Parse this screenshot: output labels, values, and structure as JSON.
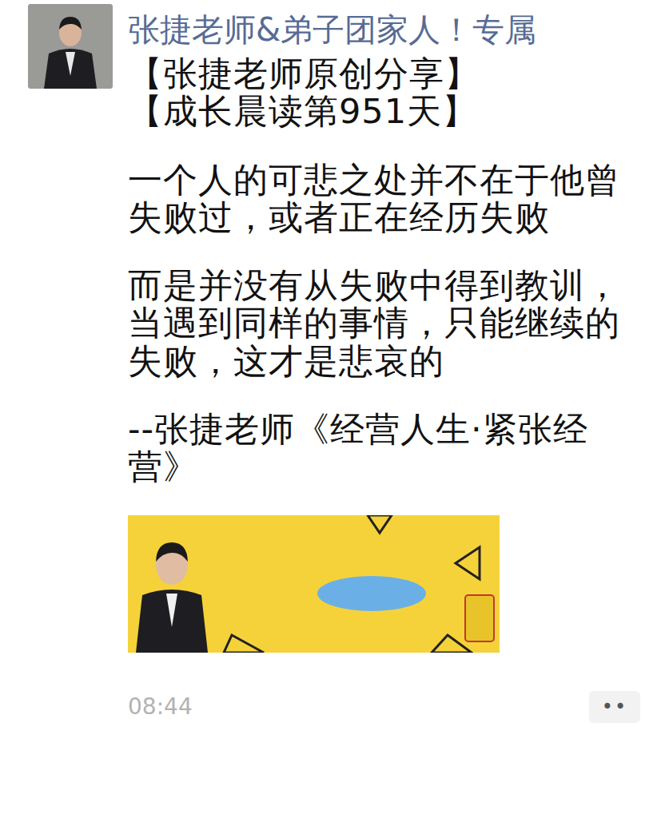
{
  "post": {
    "author": "张捷老师&弟子团家人！专属",
    "header": [
      "【张捷老师原创分享】",
      "【成长晨读第951天】"
    ],
    "paragraphs": [
      "一个人的可悲之处并不在于他曾失败过，或者正在经历失败",
      "而是并没有从失败中得到教训，当遇到同样的事情，只能继续的失败，这才是悲哀的",
      "--张捷老师《经营人生·紧张经营》"
    ],
    "time": "08:44",
    "more_button": "••"
  }
}
